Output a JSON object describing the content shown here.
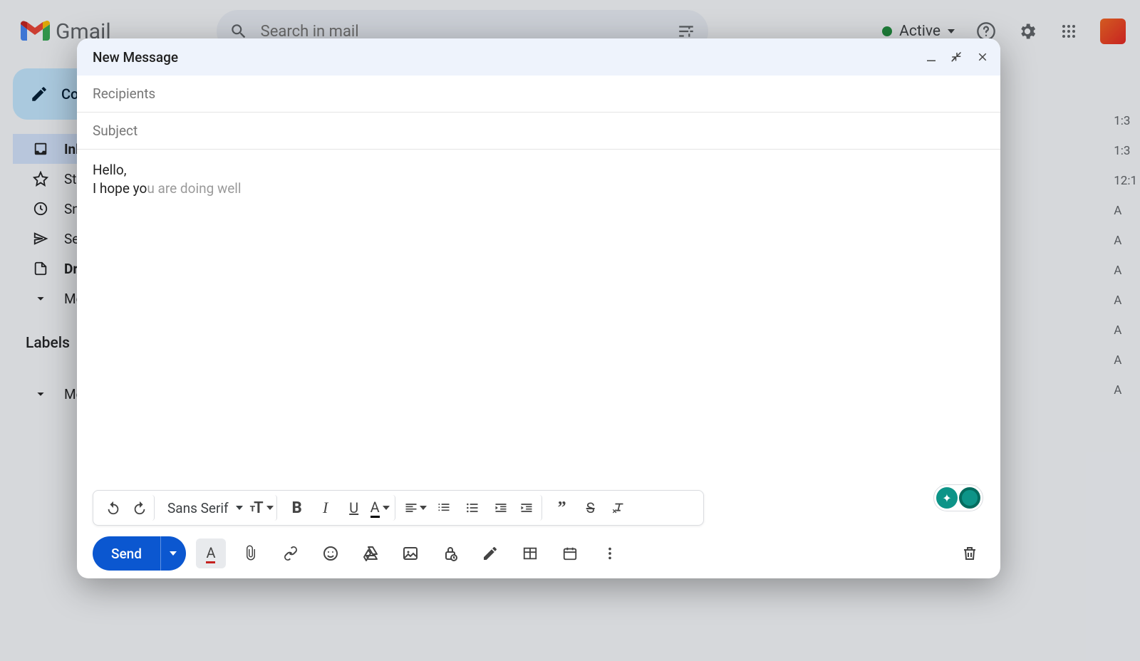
{
  "header": {
    "app_name": "Gmail",
    "search_placeholder": "Search in mail",
    "status_label": "Active"
  },
  "sidebar": {
    "compose_label": "Compose",
    "items": [
      {
        "label": "Inbox",
        "icon": "inbox"
      },
      {
        "label": "Starred",
        "icon": "star"
      },
      {
        "label": "Snoozed",
        "icon": "clock"
      },
      {
        "label": "Sent",
        "icon": "send"
      },
      {
        "label": "Drafts",
        "icon": "draft"
      },
      {
        "label": "More",
        "icon": "chevron-down"
      }
    ],
    "labels_header": "Labels",
    "label_items": [
      {
        "label": "More",
        "icon": "chevron-down"
      }
    ]
  },
  "compose": {
    "window_title": "New Message",
    "recipients_placeholder": "Recipients",
    "recipients_value": "",
    "subject_placeholder": "Subject",
    "subject_value": "",
    "body_typed": "Hello,\nI hope yo",
    "body_suggestion": "u are doing well",
    "font_family": "Sans Serif",
    "send_label": "Send"
  },
  "times": [
    "1:3",
    "1:3",
    "12:1",
    "A",
    "A",
    "A",
    "A",
    "A",
    "A",
    "A"
  ]
}
